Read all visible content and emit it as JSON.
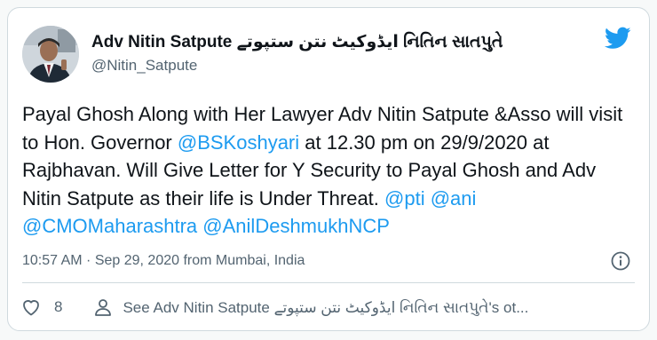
{
  "author": {
    "display_name": "Adv Nitin Satpute ایڈوکیٹ نتن ستپوتے નિતિન સાતપુતે",
    "handle": "@Nitin_Satpute"
  },
  "tweet": {
    "segments": [
      {
        "text": "Payal Ghosh Along with Her Lawyer Adv Nitin Satpute &Asso will visit to Hon. Governor ",
        "mention": false
      },
      {
        "text": "@BSKoshyari",
        "mention": true
      },
      {
        "text": " at 12.30 pm on 29/9/2020 at Rajbhavan. Will Give Letter for Y Security to Payal Ghosh and Adv Nitin Satpute as their life is Under Threat. ",
        "mention": false
      },
      {
        "text": "@pti",
        "mention": true
      },
      {
        "text": " ",
        "mention": false
      },
      {
        "text": "@ani",
        "mention": true
      },
      {
        "text": " ",
        "mention": false
      },
      {
        "text": "@CMOMaharashtra",
        "mention": true
      },
      {
        "text": " ",
        "mention": false
      },
      {
        "text": "@AnilDeshmukhNCP",
        "mention": true
      }
    ],
    "timestamp": "10:57 AM · Sep 29, 2020 from Mumbai, India"
  },
  "actions": {
    "like_count": "8",
    "see_more_label": "See Adv Nitin Satpute ایڈوکیٹ نتن ستپوتے નિતિન સાતપુતે's ot..."
  },
  "icons": {
    "brand": "twitter-bird-icon",
    "info": "info-icon",
    "like": "heart-icon",
    "profile": "person-icon"
  },
  "colors": {
    "brand": "#1d9bf0",
    "secondary_text": "#536471",
    "border": "#cfd9de"
  }
}
